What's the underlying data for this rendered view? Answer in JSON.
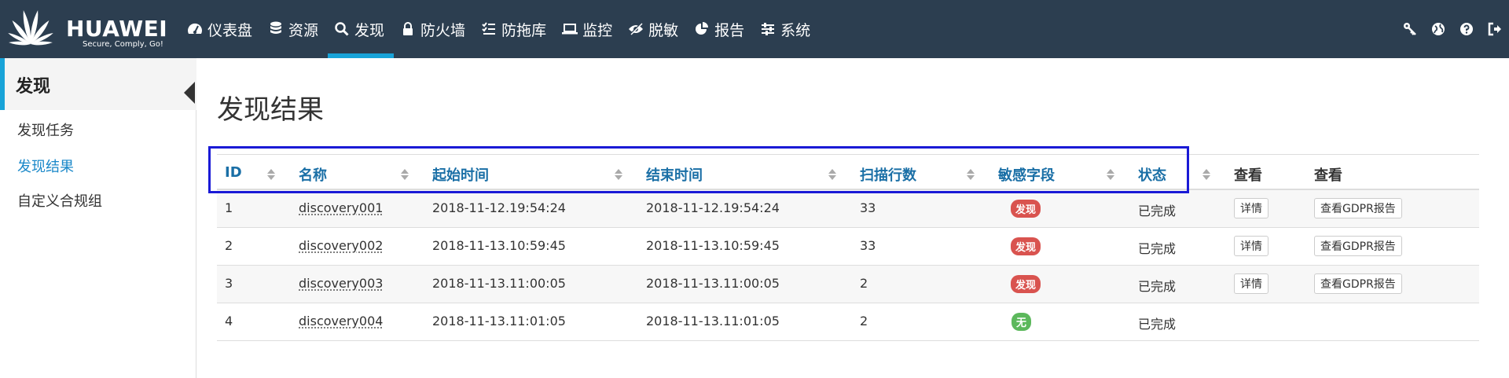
{
  "brand": {
    "name": "HUAWEI",
    "tagline": "Secure, Comply, Go!"
  },
  "nav": {
    "items": [
      {
        "label": "仪表盘",
        "icon": "dashboard-icon"
      },
      {
        "label": "资源",
        "icon": "database-icon"
      },
      {
        "label": "发现",
        "icon": "search-icon",
        "active": true
      },
      {
        "label": "防火墙",
        "icon": "lock-icon"
      },
      {
        "label": "防拖库",
        "icon": "list-check-icon"
      },
      {
        "label": "监控",
        "icon": "laptop-icon"
      },
      {
        "label": "脱敏",
        "icon": "eye-slash-icon"
      },
      {
        "label": "报告",
        "icon": "pie-chart-icon"
      },
      {
        "label": "系统",
        "icon": "sliders-icon"
      }
    ],
    "tools": [
      "key-icon",
      "globe-icon",
      "help-icon",
      "logout-icon"
    ]
  },
  "sidebar": {
    "title": "发现",
    "items": [
      {
        "label": "发现任务"
      },
      {
        "label": "发现结果",
        "active": true
      },
      {
        "label": "自定义合规组"
      }
    ]
  },
  "page": {
    "title": "发现结果"
  },
  "table": {
    "columns": [
      "ID",
      "名称",
      "起始时间",
      "结束时间",
      "扫描行数",
      "敏感字段",
      "状态",
      "查看",
      "查看"
    ],
    "rows": [
      {
        "id": "1",
        "name": "discovery001",
        "start": "2018-11-12.19:54:24",
        "end": "2018-11-12.19:54:24",
        "rows": "33",
        "sensitive": "发现",
        "status": "已完成",
        "detail": "详情",
        "report": "查看GDPR报告"
      },
      {
        "id": "2",
        "name": "discovery002",
        "start": "2018-11-13.10:59:45",
        "end": "2018-11-13.10:59:45",
        "rows": "33",
        "sensitive": "发现",
        "status": "已完成",
        "detail": "详情",
        "report": "查看GDPR报告"
      },
      {
        "id": "3",
        "name": "discovery003",
        "start": "2018-11-13.11:00:05",
        "end": "2018-11-13.11:00:05",
        "rows": "2",
        "sensitive": "发现",
        "status": "已完成",
        "detail": "详情",
        "report": "查看GDPR报告"
      },
      {
        "id": "4",
        "name": "discovery004",
        "start": "2018-11-13.11:01:05",
        "end": "2018-11-13.11:01:05",
        "rows": "2",
        "sensitive": "无",
        "status": "已完成"
      }
    ]
  },
  "colors": {
    "navbar": "#2c3e50",
    "accent": "#18a3d8",
    "badge_found": "#d9534f",
    "badge_none": "#5cb85c",
    "highlight": "#1a1ad6"
  }
}
